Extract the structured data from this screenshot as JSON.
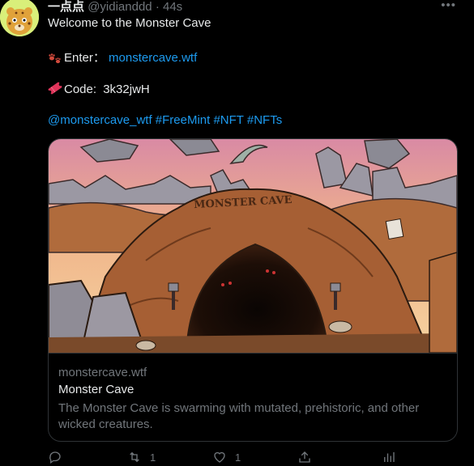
{
  "tweet": {
    "author_name": "一点点",
    "author_handle": "@yidianddd",
    "separator": "·",
    "time": "44s",
    "more_icon": "more-horizontal-icon",
    "text_line1": "Welcome to the Monster Cave",
    "enter_label": "Enter：",
    "enter_link": "monstercave.wtf",
    "code_label": "Code:",
    "code_value": "3k32jwH",
    "mentions": "@monstercave_wtf #FreeMint #NFT #NFTs"
  },
  "card": {
    "sign_text": "MONSTER CAVE",
    "domain": "monstercave.wtf",
    "title": "Monster Cave",
    "description": "The Monster Cave is swarming with mutated, prehistoric, and other wicked creatures."
  },
  "actions": {
    "reply_count": "",
    "retweet_count": "1",
    "like_count": "1"
  }
}
